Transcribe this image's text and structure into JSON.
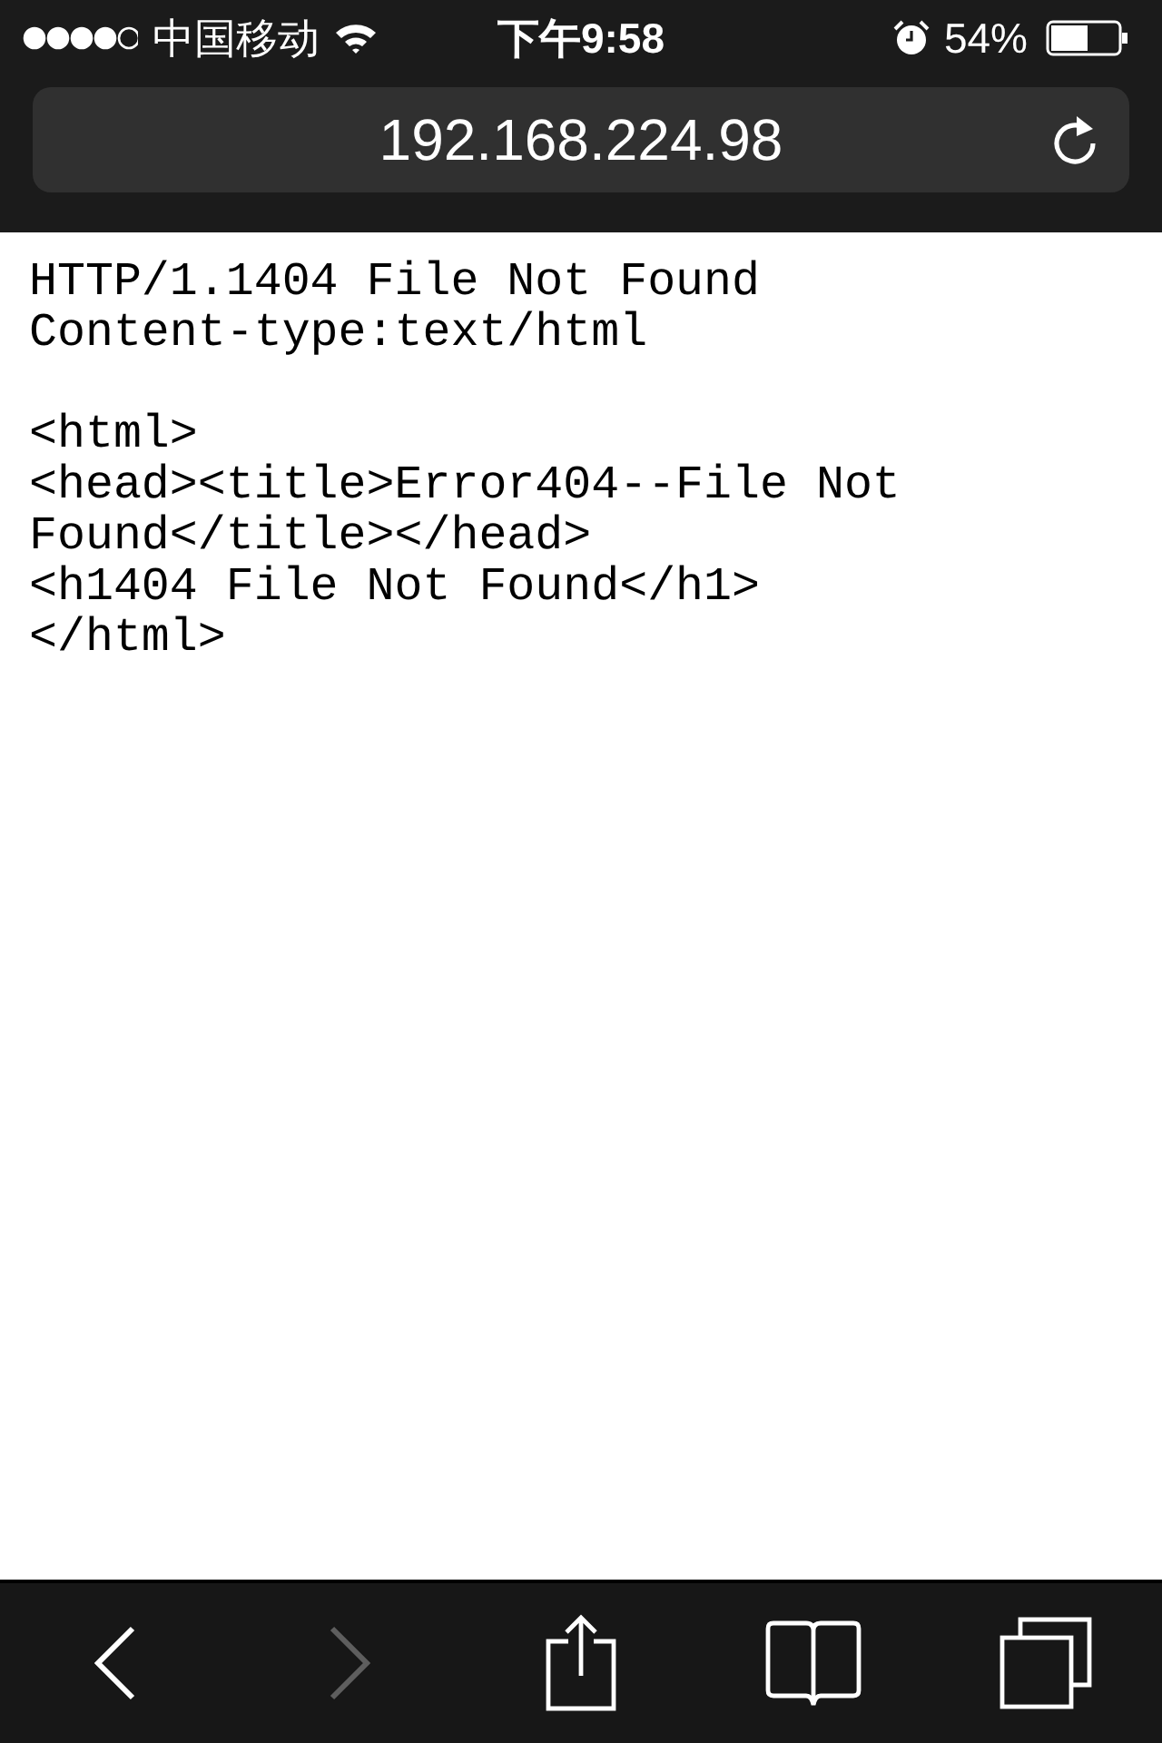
{
  "status_bar": {
    "carrier": "中国移动",
    "time": "下午9:58",
    "battery": "54%"
  },
  "address_bar": {
    "url": "192.168.224.98"
  },
  "page": {
    "blocks": [
      [
        "HTTP/1.1404 File Not Found",
        "Content-type:text/html"
      ],
      [
        "<html>",
        "<head><title>Error404--File Not",
        "Found</title></head>",
        "<h1404 File Not Found</h1>",
        "</html>"
      ]
    ]
  },
  "toolbar": [
    {
      "kind": "back",
      "disabled": false
    },
    {
      "kind": "forward",
      "disabled": true
    },
    {
      "kind": "share",
      "disabled": false
    },
    {
      "kind": "bookmarks",
      "disabled": false
    },
    {
      "kind": "tabs",
      "disabled": false
    }
  ]
}
